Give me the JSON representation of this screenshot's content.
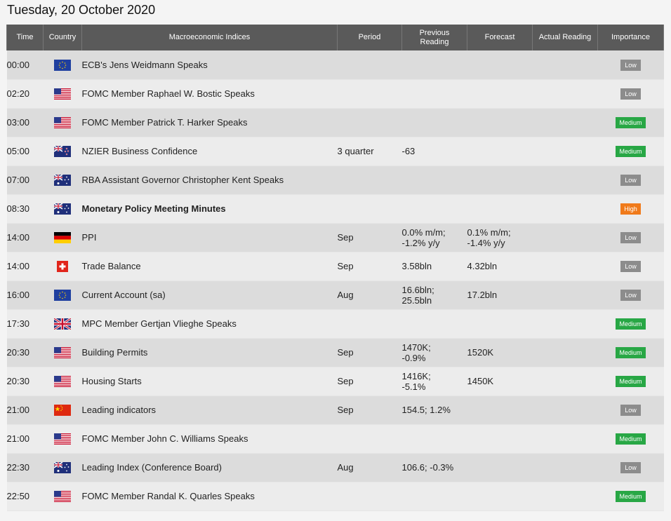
{
  "page": {
    "title": "Tuesday, 20 October 2020"
  },
  "table": {
    "headers": {
      "time": "Time",
      "country": "Country",
      "indices": "Macroeconomic Indices",
      "period": "Period",
      "previous": "Previous Reading",
      "forecast": "Forecast",
      "actual": "Actual Reading",
      "importance": "Importance"
    },
    "rows": [
      {
        "time": "00:00",
        "flag": "eu-flag-icon",
        "name": "ECB's Jens Weidmann Speaks",
        "bold": false,
        "period": "",
        "prev1": "",
        "prev2": "",
        "fc1": "",
        "fc2": "",
        "actual": "",
        "importance": "Low",
        "level": "low"
      },
      {
        "time": "02:20",
        "flag": "us-flag-icon",
        "name": "FOMC Member Raphael W. Bostic Speaks",
        "bold": false,
        "period": "",
        "prev1": "",
        "prev2": "",
        "fc1": "",
        "fc2": "",
        "actual": "",
        "importance": "Low",
        "level": "low"
      },
      {
        "time": "03:00",
        "flag": "us-flag-icon",
        "name": "FOMC Member Patrick T. Harker Speaks",
        "bold": false,
        "period": "",
        "prev1": "",
        "prev2": "",
        "fc1": "",
        "fc2": "",
        "actual": "",
        "importance": "Medium",
        "level": "medium"
      },
      {
        "time": "05:00",
        "flag": "nz-flag-icon",
        "name": "NZIER Business Confidence",
        "bold": false,
        "period": "3 quarter",
        "prev1": "-63",
        "prev2": "",
        "fc1": "",
        "fc2": "",
        "actual": "",
        "importance": "Medium",
        "level": "medium"
      },
      {
        "time": "07:00",
        "flag": "au-flag-icon",
        "name": "RBA Assistant Governor Christopher Kent Speaks",
        "bold": false,
        "period": "",
        "prev1": "",
        "prev2": "",
        "fc1": "",
        "fc2": "",
        "actual": "",
        "importance": "Low",
        "level": "low"
      },
      {
        "time": "08:30",
        "flag": "au-flag-icon",
        "name": "Monetary Policy Meeting Minutes",
        "bold": true,
        "period": "",
        "prev1": "",
        "prev2": "",
        "fc1": "",
        "fc2": "",
        "actual": "",
        "importance": "High",
        "level": "high"
      },
      {
        "time": "14:00",
        "flag": "de-flag-icon",
        "name": "PPI",
        "bold": false,
        "period": "Sep",
        "prev1": "0.0% m/m;",
        "prev2": "-1.2% y/y",
        "fc1": "0.1% m/m;",
        "fc2": "-1.4% y/y",
        "actual": "",
        "importance": "Low",
        "level": "low"
      },
      {
        "time": "14:00",
        "flag": "ch-flag-icon",
        "name": "Trade Balance",
        "bold": false,
        "period": "Sep",
        "prev1": "3.58bln",
        "prev2": "",
        "fc1": "4.32bln",
        "fc2": "",
        "actual": "",
        "importance": "Low",
        "level": "low"
      },
      {
        "time": "16:00",
        "flag": "eu-flag-icon",
        "name": "Current Account (sa)",
        "bold": false,
        "period": "Aug",
        "prev1": "16.6bln;",
        "prev2": "25.5bln",
        "fc1": "17.2bln",
        "fc2": "",
        "actual": "",
        "importance": "Low",
        "level": "low"
      },
      {
        "time": "17:30",
        "flag": "uk-flag-icon",
        "name": "MPC Member Gertjan Vlieghe Speaks",
        "bold": false,
        "period": "",
        "prev1": "",
        "prev2": "",
        "fc1": "",
        "fc2": "",
        "actual": "",
        "importance": "Medium",
        "level": "medium"
      },
      {
        "time": "20:30",
        "flag": "us-flag-icon",
        "name": "Building Permits",
        "bold": false,
        "period": "Sep",
        "prev1": "1470K;",
        "prev2": "-0.9%",
        "fc1": "1520K",
        "fc2": "",
        "actual": "",
        "importance": "Medium",
        "level": "medium"
      },
      {
        "time": "20:30",
        "flag": "us-flag-icon",
        "name": "Housing Starts",
        "bold": false,
        "period": "Sep",
        "prev1": "1416K;",
        "prev2": "-5.1%",
        "fc1": "1450K",
        "fc2": "",
        "actual": "",
        "importance": "Medium",
        "level": "medium"
      },
      {
        "time": "21:00",
        "flag": "cn-flag-icon",
        "name": "Leading indicators",
        "bold": false,
        "period": "Sep",
        "prev1": "154.5; 1.2%",
        "prev2": "",
        "fc1": "",
        "fc2": "",
        "actual": "",
        "importance": "Low",
        "level": "low"
      },
      {
        "time": "21:00",
        "flag": "us-flag-icon",
        "name": "FOMC Member John C. Williams Speaks",
        "bold": false,
        "period": "",
        "prev1": "",
        "prev2": "",
        "fc1": "",
        "fc2": "",
        "actual": "",
        "importance": "Medium",
        "level": "medium"
      },
      {
        "time": "22:30",
        "flag": "au-flag-icon",
        "name": "Leading Index (Conference Board)",
        "bold": false,
        "period": "Aug",
        "prev1": "106.6; -0.3%",
        "prev2": "",
        "fc1": "",
        "fc2": "",
        "actual": "",
        "importance": "Low",
        "level": "low"
      },
      {
        "time": "22:50",
        "flag": "us-flag-icon",
        "name": "FOMC Member Randal K. Quarles Speaks",
        "bold": false,
        "period": "",
        "prev1": "",
        "prev2": "",
        "fc1": "",
        "fc2": "",
        "actual": "",
        "importance": "Medium",
        "level": "medium"
      }
    ]
  },
  "colors": {
    "header_bg": "#5a5a5a",
    "low": "#8c8c8c",
    "medium": "#28a745",
    "high": "#f07a1a"
  }
}
